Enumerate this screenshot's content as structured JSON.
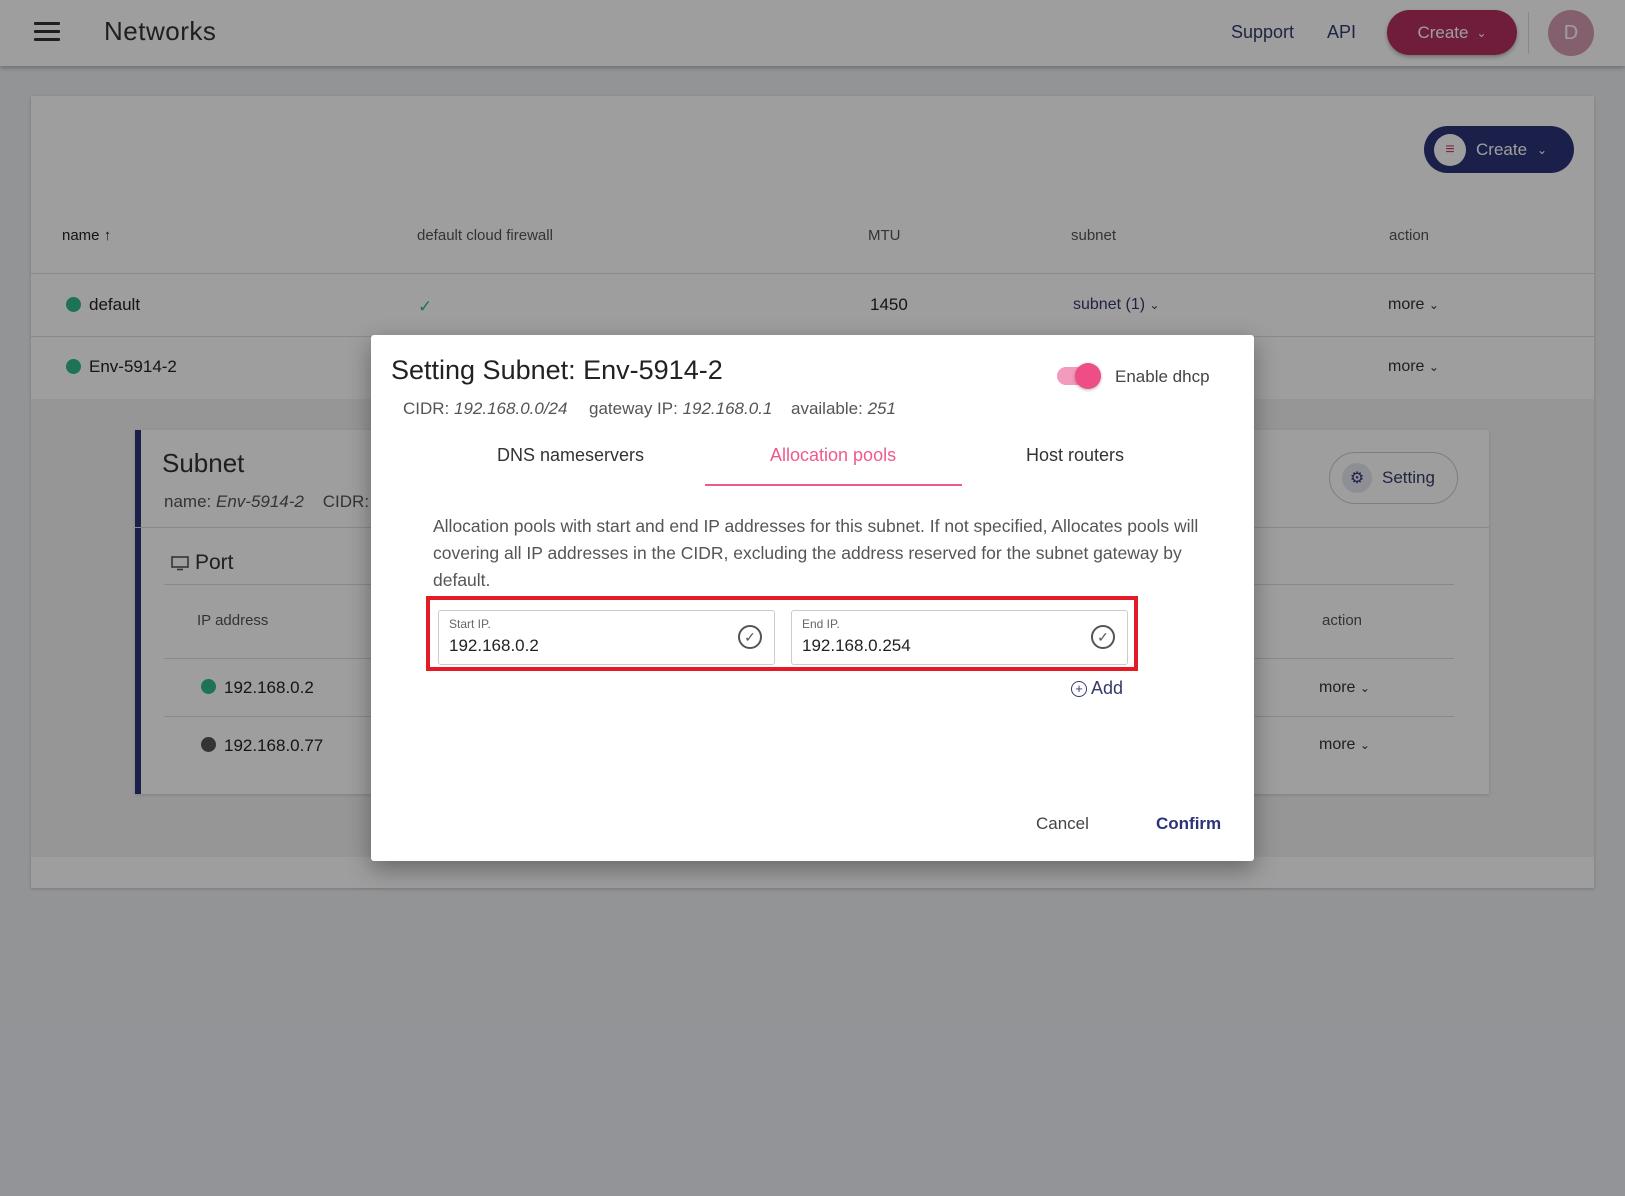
{
  "header": {
    "title": "Networks",
    "links": [
      "Support",
      "API"
    ],
    "create_label": "Create",
    "avatar_initial": "D"
  },
  "card": {
    "create_label": "Create",
    "columns": [
      "name",
      "default cloud firewall",
      "MTU",
      "subnet",
      "action"
    ],
    "sort_arrow": "↑",
    "rows": [
      {
        "name": "default",
        "status": "green",
        "firewall": "✓",
        "mtu": "1450",
        "subnet": "subnet (1)",
        "action": "more"
      },
      {
        "name": "Env-5914-2",
        "status": "green",
        "firewall": "",
        "mtu": "",
        "subnet": "",
        "action": "more"
      }
    ]
  },
  "subnet_panel": {
    "title": "Subnet",
    "name_label": "name:",
    "name_value": "Env-5914-2",
    "cidr_label": "CIDR:",
    "setting_label": "Setting",
    "port_label": "Port",
    "columns": [
      "IP address",
      "action"
    ],
    "ports": [
      {
        "ip": "192.168.0.2",
        "status": "green",
        "action": "more"
      },
      {
        "ip": "192.168.0.77",
        "status": "gray",
        "action": "more"
      }
    ]
  },
  "modal": {
    "title": "Setting Subnet: Env-5914-2",
    "dhcp_label": "Enable dhcp",
    "dhcp_enabled": true,
    "cidr_label": "CIDR:",
    "cidr_value": "192.168.0.0/24",
    "gateway_label": "gateway IP:",
    "gateway_value": "192.168.0.1",
    "available_label": "available:",
    "available_value": "251",
    "tabs": [
      "DNS nameservers",
      "Allocation pools",
      "Host routers"
    ],
    "active_tab": "Allocation pools",
    "description": "Allocation pools with start and end IP addresses for this subnet. If not specified, Allocates pools will covering all IP addresses in the CIDR, excluding the address reserved for the subnet gateway by default.",
    "start_label": "Start IP.",
    "start_value": "192.168.0.2",
    "end_label": "End IP.",
    "end_value": "192.168.0.254",
    "add_label": "Add",
    "cancel_label": "Cancel",
    "confirm_label": "Confirm"
  },
  "colors": {
    "primary": "#2c3478",
    "accent": "#ef5a8e",
    "create_top": "#b3305e",
    "status_green": "#2fb98d",
    "highlight": "#e21b25"
  }
}
